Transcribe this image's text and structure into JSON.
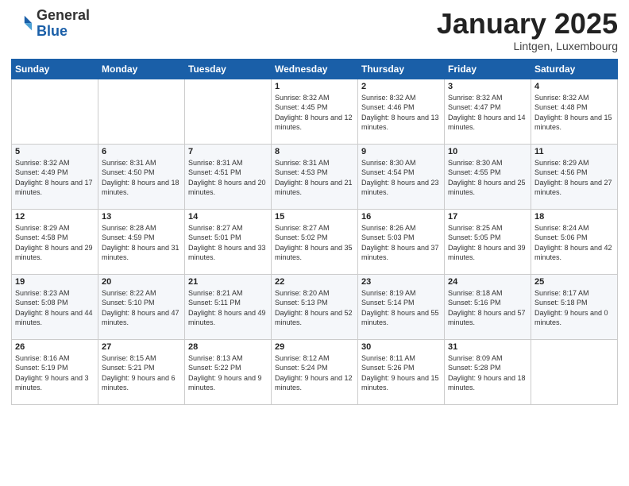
{
  "logo": {
    "general": "General",
    "blue": "Blue"
  },
  "header": {
    "month": "January 2025",
    "location": "Lintgen, Luxembourg"
  },
  "weekdays": [
    "Sunday",
    "Monday",
    "Tuesday",
    "Wednesday",
    "Thursday",
    "Friday",
    "Saturday"
  ],
  "weeks": [
    [
      {
        "day": "",
        "sunrise": "",
        "sunset": "",
        "daylight": ""
      },
      {
        "day": "",
        "sunrise": "",
        "sunset": "",
        "daylight": ""
      },
      {
        "day": "",
        "sunrise": "",
        "sunset": "",
        "daylight": ""
      },
      {
        "day": "1",
        "sunrise": "Sunrise: 8:32 AM",
        "sunset": "Sunset: 4:45 PM",
        "daylight": "Daylight: 8 hours and 12 minutes."
      },
      {
        "day": "2",
        "sunrise": "Sunrise: 8:32 AM",
        "sunset": "Sunset: 4:46 PM",
        "daylight": "Daylight: 8 hours and 13 minutes."
      },
      {
        "day": "3",
        "sunrise": "Sunrise: 8:32 AM",
        "sunset": "Sunset: 4:47 PM",
        "daylight": "Daylight: 8 hours and 14 minutes."
      },
      {
        "day": "4",
        "sunrise": "Sunrise: 8:32 AM",
        "sunset": "Sunset: 4:48 PM",
        "daylight": "Daylight: 8 hours and 15 minutes."
      }
    ],
    [
      {
        "day": "5",
        "sunrise": "Sunrise: 8:32 AM",
        "sunset": "Sunset: 4:49 PM",
        "daylight": "Daylight: 8 hours and 17 minutes."
      },
      {
        "day": "6",
        "sunrise": "Sunrise: 8:31 AM",
        "sunset": "Sunset: 4:50 PM",
        "daylight": "Daylight: 8 hours and 18 minutes."
      },
      {
        "day": "7",
        "sunrise": "Sunrise: 8:31 AM",
        "sunset": "Sunset: 4:51 PM",
        "daylight": "Daylight: 8 hours and 20 minutes."
      },
      {
        "day": "8",
        "sunrise": "Sunrise: 8:31 AM",
        "sunset": "Sunset: 4:53 PM",
        "daylight": "Daylight: 8 hours and 21 minutes."
      },
      {
        "day": "9",
        "sunrise": "Sunrise: 8:30 AM",
        "sunset": "Sunset: 4:54 PM",
        "daylight": "Daylight: 8 hours and 23 minutes."
      },
      {
        "day": "10",
        "sunrise": "Sunrise: 8:30 AM",
        "sunset": "Sunset: 4:55 PM",
        "daylight": "Daylight: 8 hours and 25 minutes."
      },
      {
        "day": "11",
        "sunrise": "Sunrise: 8:29 AM",
        "sunset": "Sunset: 4:56 PM",
        "daylight": "Daylight: 8 hours and 27 minutes."
      }
    ],
    [
      {
        "day": "12",
        "sunrise": "Sunrise: 8:29 AM",
        "sunset": "Sunset: 4:58 PM",
        "daylight": "Daylight: 8 hours and 29 minutes."
      },
      {
        "day": "13",
        "sunrise": "Sunrise: 8:28 AM",
        "sunset": "Sunset: 4:59 PM",
        "daylight": "Daylight: 8 hours and 31 minutes."
      },
      {
        "day": "14",
        "sunrise": "Sunrise: 8:27 AM",
        "sunset": "Sunset: 5:01 PM",
        "daylight": "Daylight: 8 hours and 33 minutes."
      },
      {
        "day": "15",
        "sunrise": "Sunrise: 8:27 AM",
        "sunset": "Sunset: 5:02 PM",
        "daylight": "Daylight: 8 hours and 35 minutes."
      },
      {
        "day": "16",
        "sunrise": "Sunrise: 8:26 AM",
        "sunset": "Sunset: 5:03 PM",
        "daylight": "Daylight: 8 hours and 37 minutes."
      },
      {
        "day": "17",
        "sunrise": "Sunrise: 8:25 AM",
        "sunset": "Sunset: 5:05 PM",
        "daylight": "Daylight: 8 hours and 39 minutes."
      },
      {
        "day": "18",
        "sunrise": "Sunrise: 8:24 AM",
        "sunset": "Sunset: 5:06 PM",
        "daylight": "Daylight: 8 hours and 42 minutes."
      }
    ],
    [
      {
        "day": "19",
        "sunrise": "Sunrise: 8:23 AM",
        "sunset": "Sunset: 5:08 PM",
        "daylight": "Daylight: 8 hours and 44 minutes."
      },
      {
        "day": "20",
        "sunrise": "Sunrise: 8:22 AM",
        "sunset": "Sunset: 5:10 PM",
        "daylight": "Daylight: 8 hours and 47 minutes."
      },
      {
        "day": "21",
        "sunrise": "Sunrise: 8:21 AM",
        "sunset": "Sunset: 5:11 PM",
        "daylight": "Daylight: 8 hours and 49 minutes."
      },
      {
        "day": "22",
        "sunrise": "Sunrise: 8:20 AM",
        "sunset": "Sunset: 5:13 PM",
        "daylight": "Daylight: 8 hours and 52 minutes."
      },
      {
        "day": "23",
        "sunrise": "Sunrise: 8:19 AM",
        "sunset": "Sunset: 5:14 PM",
        "daylight": "Daylight: 8 hours and 55 minutes."
      },
      {
        "day": "24",
        "sunrise": "Sunrise: 8:18 AM",
        "sunset": "Sunset: 5:16 PM",
        "daylight": "Daylight: 8 hours and 57 minutes."
      },
      {
        "day": "25",
        "sunrise": "Sunrise: 8:17 AM",
        "sunset": "Sunset: 5:18 PM",
        "daylight": "Daylight: 9 hours and 0 minutes."
      }
    ],
    [
      {
        "day": "26",
        "sunrise": "Sunrise: 8:16 AM",
        "sunset": "Sunset: 5:19 PM",
        "daylight": "Daylight: 9 hours and 3 minutes."
      },
      {
        "day": "27",
        "sunrise": "Sunrise: 8:15 AM",
        "sunset": "Sunset: 5:21 PM",
        "daylight": "Daylight: 9 hours and 6 minutes."
      },
      {
        "day": "28",
        "sunrise": "Sunrise: 8:13 AM",
        "sunset": "Sunset: 5:22 PM",
        "daylight": "Daylight: 9 hours and 9 minutes."
      },
      {
        "day": "29",
        "sunrise": "Sunrise: 8:12 AM",
        "sunset": "Sunset: 5:24 PM",
        "daylight": "Daylight: 9 hours and 12 minutes."
      },
      {
        "day": "30",
        "sunrise": "Sunrise: 8:11 AM",
        "sunset": "Sunset: 5:26 PM",
        "daylight": "Daylight: 9 hours and 15 minutes."
      },
      {
        "day": "31",
        "sunrise": "Sunrise: 8:09 AM",
        "sunset": "Sunset: 5:28 PM",
        "daylight": "Daylight: 9 hours and 18 minutes."
      },
      {
        "day": "",
        "sunrise": "",
        "sunset": "",
        "daylight": ""
      }
    ]
  ]
}
